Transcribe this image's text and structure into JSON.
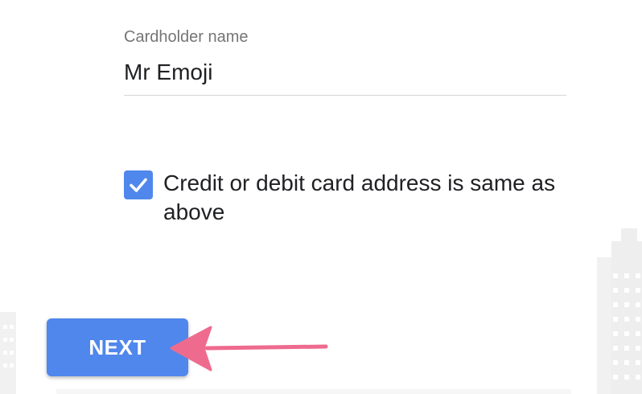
{
  "cardholder": {
    "label": "Cardholder name",
    "value": "Mr Emoji"
  },
  "address_checkbox": {
    "checked": true,
    "label": "Credit or debit card address is same as above"
  },
  "next_button": {
    "label": "NEXT"
  },
  "colors": {
    "primary": "#4f87ec",
    "arrow": "#ee6b8e",
    "label_grey": "#757575",
    "text": "#202124"
  },
  "icons": {
    "checkbox": "check-icon",
    "annotation": "pink-arrow-icon",
    "background": "city-buildings-illustration"
  }
}
